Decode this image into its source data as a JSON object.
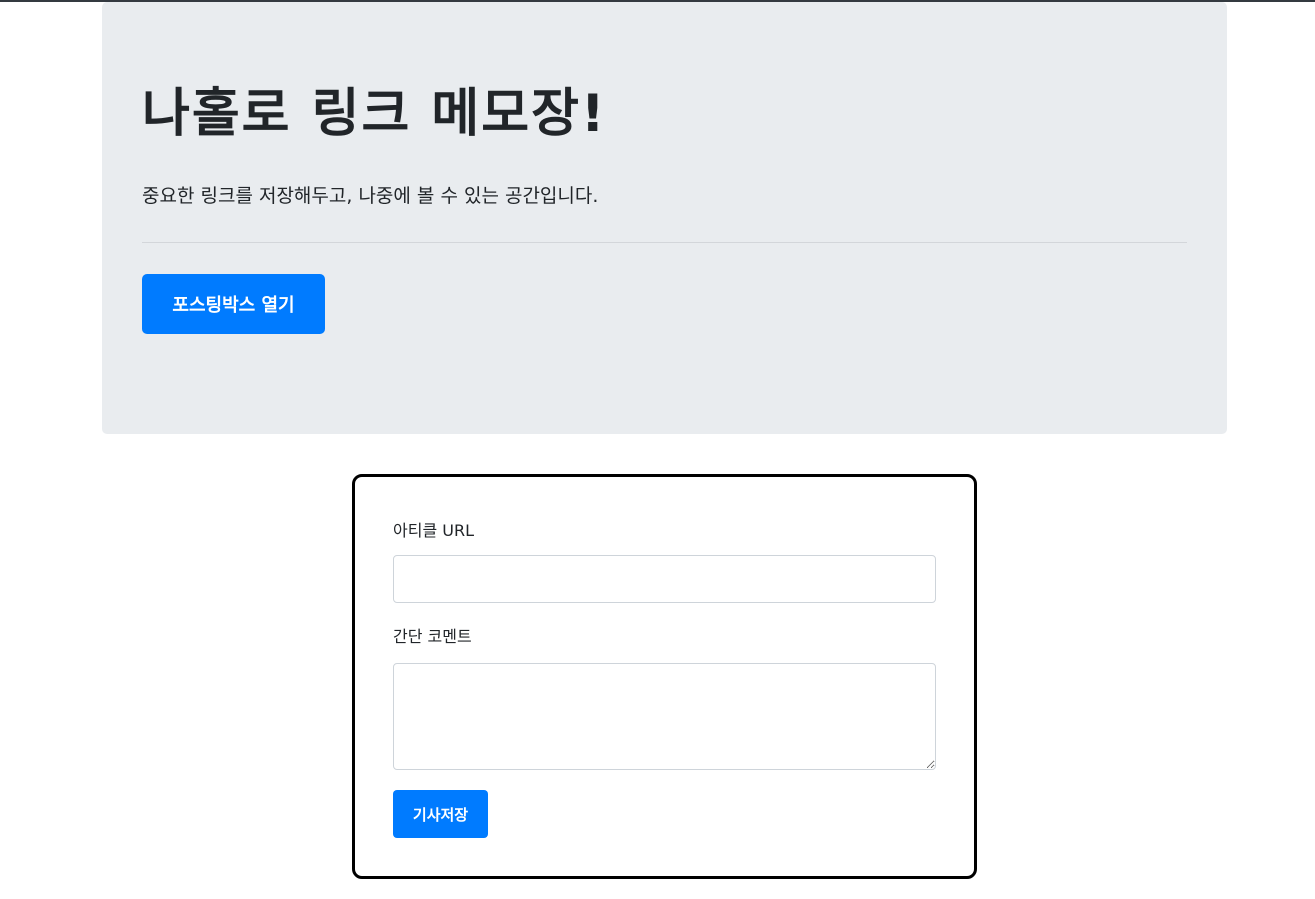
{
  "jumbotron": {
    "title": "나홀로 링크 메모장!",
    "lead": "중요한 링크를 저장해두고, 나중에 볼 수 있는 공간입니다.",
    "open_button_label": "포스팅박스 열기"
  },
  "posting_box": {
    "url_label": "아티클 URL",
    "url_value": "",
    "comment_label": "간단 코멘트",
    "comment_value": "",
    "save_button_label": "기사저장"
  },
  "colors": {
    "primary": "#007bff",
    "jumbotron_bg": "#e9ecef",
    "box_border": "#000000"
  }
}
